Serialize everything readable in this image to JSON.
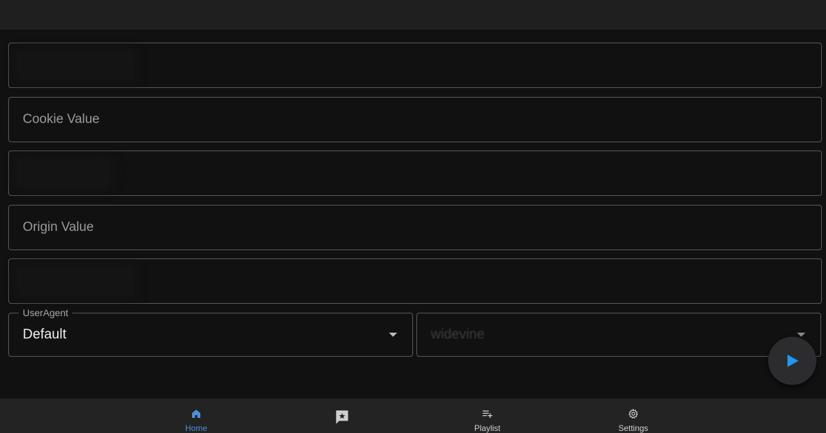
{
  "fields": [
    {
      "placeholder": ""
    },
    {
      "placeholder": "Cookie Value"
    },
    {
      "placeholder": ""
    },
    {
      "placeholder": "Origin Value"
    },
    {
      "placeholder": ""
    }
  ],
  "useragent_select": {
    "label": "UserAgent",
    "value": "Default"
  },
  "drm_select": {
    "label": "",
    "value": "widevine"
  },
  "nav": {
    "items": [
      {
        "label": "Home",
        "icon": "home-icon",
        "active": true
      },
      {
        "label": "",
        "icon": "favorites-flag-icon",
        "active": false
      },
      {
        "label": "Playlist",
        "icon": "playlist-add-icon",
        "active": false
      },
      {
        "label": "Settings",
        "icon": "settings-gear-icon",
        "active": false
      }
    ]
  },
  "fab": {
    "icon": "play-icon"
  },
  "colors": {
    "background": "#111111",
    "topbar": "#1f1f1f",
    "accent_blue": "#4f8fdc",
    "play_blue": "#2196f3",
    "border": "#5c5c5c"
  }
}
